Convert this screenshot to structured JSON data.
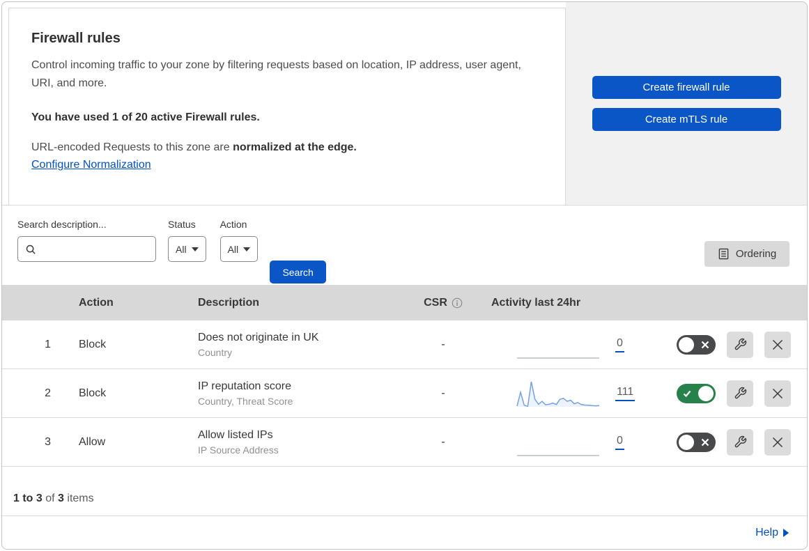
{
  "header": {
    "title": "Firewall rules",
    "description": "Control incoming traffic to your zone by filtering requests based on location, IP address, user agent, URI, and more.",
    "usage_notice": "You have used 1 of 20 active Firewall rules.",
    "normalization_prefix": "URL-encoded Requests to this zone are ",
    "normalization_bold": "normalized at the edge.",
    "normalization_link": "Configure Normalization",
    "create_firewall_button": "Create firewall rule",
    "create_mtls_button": "Create mTLS rule"
  },
  "filters": {
    "search_label": "Search description...",
    "status_label": "Status",
    "status_value": "All",
    "action_label": "Action",
    "action_value": "All",
    "search_button": "Search",
    "ordering_button": "Ordering"
  },
  "table": {
    "columns": {
      "action": "Action",
      "description": "Description",
      "csr": "CSR",
      "activity": "Activity last 24hr"
    },
    "rows": [
      {
        "number": "1",
        "action": "Block",
        "description": "Does not originate in UK",
        "criteria": "Country",
        "csr": "-",
        "activity_count": "0",
        "enabled": false,
        "sparkline": [
          0,
          0,
          0,
          0,
          0,
          0,
          0,
          0,
          0,
          0,
          0,
          0
        ]
      },
      {
        "number": "2",
        "action": "Block",
        "description": "IP reputation score",
        "criteria": "Country, Threat Score",
        "csr": "-",
        "activity_count": "111",
        "enabled": true,
        "sparkline": [
          3,
          58,
          6,
          2,
          100,
          30,
          10,
          22,
          8,
          10,
          15,
          9,
          30,
          34,
          22,
          26,
          12,
          17,
          9,
          7,
          6,
          5,
          4,
          5
        ]
      },
      {
        "number": "3",
        "action": "Allow",
        "description": "Allow listed IPs",
        "criteria": "IP Source Address",
        "csr": "-",
        "activity_count": "0",
        "enabled": false,
        "sparkline": [
          0,
          0,
          0,
          0,
          0,
          0,
          0,
          0,
          0,
          0,
          0,
          0
        ]
      }
    ]
  },
  "footer": {
    "range_bold": "1 to 3",
    "of_text": " of ",
    "total_bold": "3",
    "items_text": " items",
    "help_label": "Help"
  },
  "colors": {
    "accent_blue": "#0a56c7",
    "link_blue": "#0051c3",
    "toggle_on_green": "#27814a",
    "toggle_off_gray": "#47494b",
    "sparkline_blue": "#74a0e4",
    "sparkline_flat": "#b9bfc6",
    "panel_gray": "#f1f1f1",
    "table_header_gray": "#d8d8d8"
  }
}
